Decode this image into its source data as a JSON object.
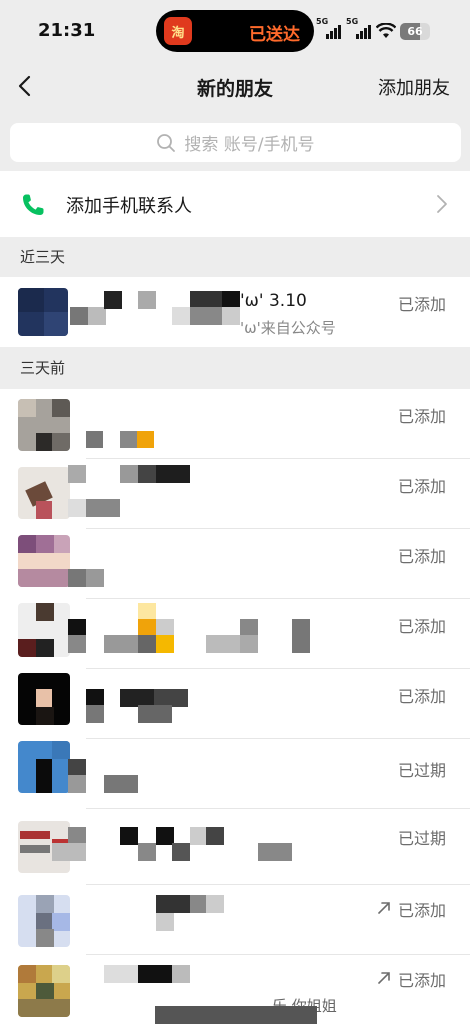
{
  "status_bar": {
    "time": "21:31",
    "island_app_icon": "淘",
    "island_text": "已送达",
    "signal_1_label": "5G",
    "signal_2_label": "5G",
    "battery": "66"
  },
  "nav": {
    "back_icon": "chevron-left-icon",
    "title": "新的朋友",
    "action": "添加朋友"
  },
  "search": {
    "placeholder": "搜索 账号/手机号",
    "icon": "search-icon"
  },
  "contacts_entry": {
    "label": "添加手机联系人",
    "icon": "phone-icon",
    "accent": "#07c160"
  },
  "sections": [
    {
      "title": "近三天",
      "items": [
        {
          "name": "'ω' 3.10",
          "sub": "'ω'来自公众号",
          "status": "已添加",
          "arrow": false
        }
      ]
    },
    {
      "title": "三天前",
      "items": [
        {
          "status": "已添加",
          "arrow": false
        },
        {
          "status": "已添加",
          "arrow": false
        },
        {
          "status": "已添加",
          "arrow": false
        },
        {
          "status": "已添加",
          "arrow": false
        },
        {
          "status": "已添加",
          "arrow": false
        },
        {
          "status": "已过期",
          "arrow": false
        },
        {
          "status": "已过期",
          "arrow": false
        },
        {
          "status": "已添加",
          "arrow": true
        },
        {
          "status": "已添加",
          "arrow": true,
          "sub": "乐 你姐姐"
        }
      ]
    }
  ]
}
